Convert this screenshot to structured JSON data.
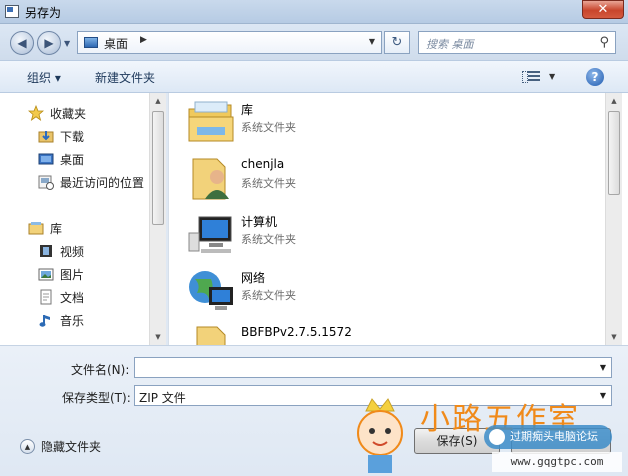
{
  "window": {
    "title": "另存为",
    "close_label": "✕"
  },
  "address": {
    "location": "桌面",
    "search_placeholder": "搜索 桌面"
  },
  "toolbar": {
    "organize_label": "组织 ▾",
    "new_folder_label": "新建文件夹",
    "help_label": "?"
  },
  "sidebar": {
    "favorites": {
      "label": "收藏夹",
      "items": [
        {
          "label": "下载",
          "icon": "download-folder-icon"
        },
        {
          "label": "桌面",
          "icon": "desktop-icon"
        },
        {
          "label": "最近访问的位置",
          "icon": "recent-places-icon"
        }
      ]
    },
    "libraries": {
      "label": "库",
      "items": [
        {
          "label": "视频",
          "icon": "video-library-icon"
        },
        {
          "label": "图片",
          "icon": "picture-library-icon"
        },
        {
          "label": "文档",
          "icon": "document-library-icon"
        },
        {
          "label": "音乐",
          "icon": "music-library-icon"
        }
      ]
    }
  },
  "files": [
    {
      "name": "库",
      "type": "系统文件夹",
      "icon": "library-folder-icon"
    },
    {
      "name": "chenjla",
      "type": "系统文件夹",
      "icon": "user-folder-icon"
    },
    {
      "name": "计算机",
      "type": "系统文件夹",
      "icon": "computer-icon"
    },
    {
      "name": "网络",
      "type": "系统文件夹",
      "icon": "network-icon"
    },
    {
      "name": "BBFBPv2.7.5.1572",
      "type": "",
      "icon": "folder-icon"
    }
  ],
  "form": {
    "filename_label": "文件名(N):",
    "filename_value": "",
    "filetype_label": "保存类型(T):",
    "filetype_value": "ZIP 文件"
  },
  "footer": {
    "hide_folders_label": "隐藏文件夹",
    "save_label": "保存(S)"
  },
  "watermark": {
    "brand": "小路五作室",
    "badge": "过期痴头电脑论坛",
    "url": "www.gqgtpc.com"
  }
}
